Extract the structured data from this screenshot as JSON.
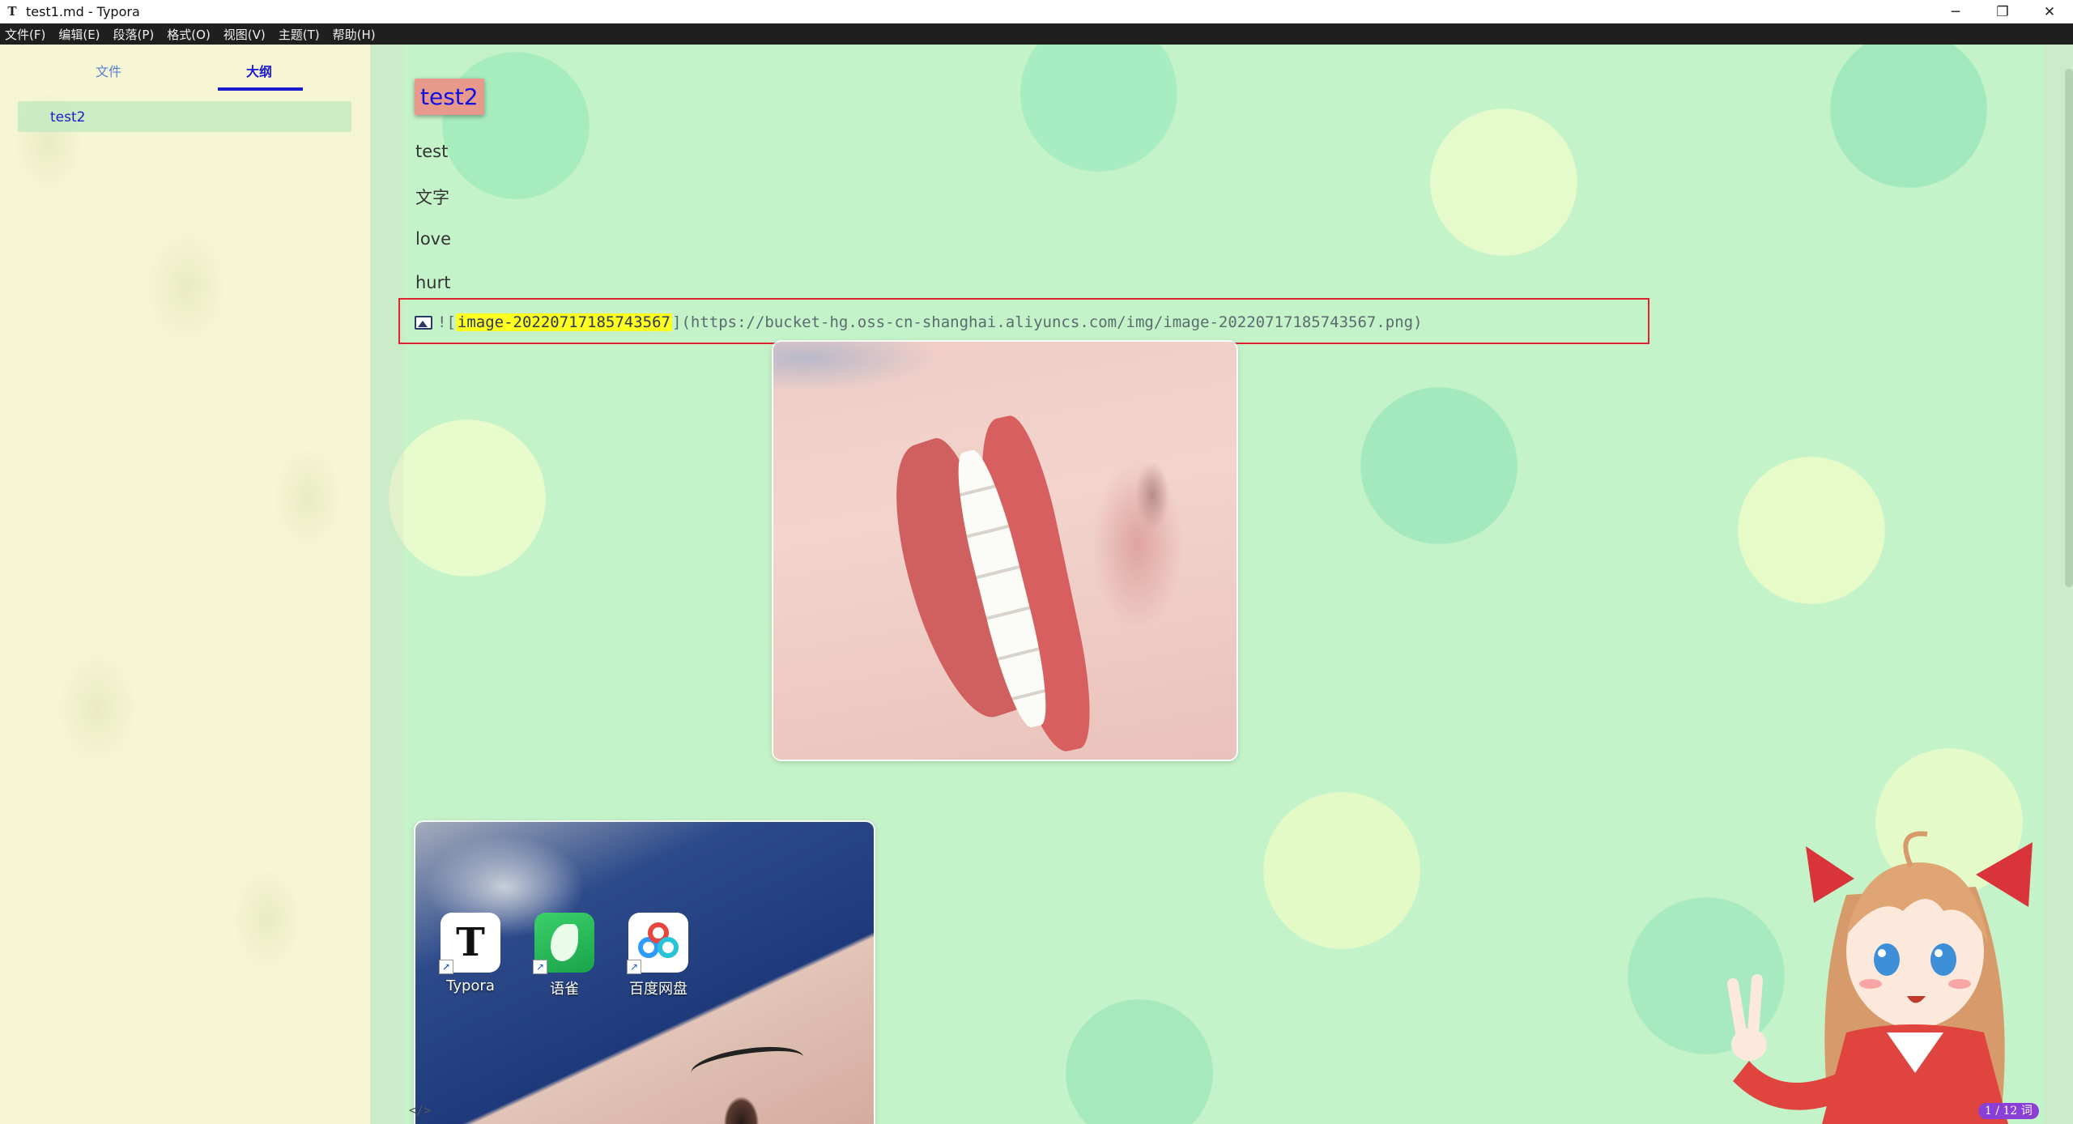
{
  "window": {
    "app_icon": "T",
    "title": "test1.md - Typora",
    "controls": {
      "minimize": "─",
      "restore": "❐",
      "close": "✕"
    }
  },
  "menu": [
    "文件(F)",
    "编辑(E)",
    "段落(P)",
    "格式(O)",
    "视图(V)",
    "主题(T)",
    "帮助(H)"
  ],
  "sidebar": {
    "tabs": {
      "files": "文件",
      "outline": "大纲"
    },
    "active_tab": "outline",
    "outline_items": [
      "test2"
    ],
    "toggle_icon": "‹"
  },
  "document": {
    "heading": "test2",
    "paragraphs": [
      "test",
      "文字",
      "love",
      "hurt"
    ],
    "image_markdown": {
      "open": "![",
      "alt": "image-20220717185743567",
      "close": "](https://bucket-hg.oss-cn-shanghai.aliyuncs.com/img/image-20220717185743567.png)"
    },
    "desktop_icons": [
      {
        "label": "Typora",
        "glyph": "T"
      },
      {
        "label": "语雀",
        "glyph": ""
      },
      {
        "label": "百度网盘",
        "glyph": ""
      }
    ],
    "shortcut_arrow": "↗"
  },
  "statusbar": {
    "source_toggle": "</>",
    "word_count": "1 / 12 词"
  },
  "colors": {
    "menubar_bg": "#1f1f1f",
    "heading_bg": "#e79a8c",
    "heading_text": "#1010e0",
    "highlight": "#ffff20",
    "selection_box": "#e0242c",
    "outline_active": "#1a1ad0",
    "word_badge": "#8a3fd6"
  }
}
